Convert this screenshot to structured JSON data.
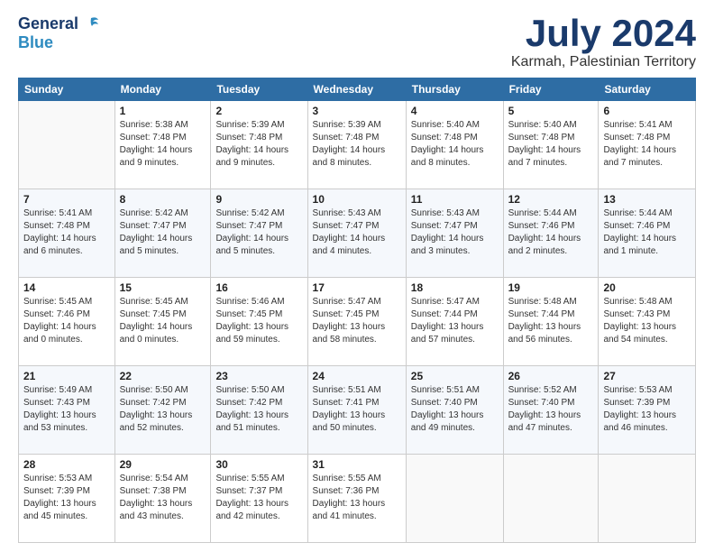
{
  "logo": {
    "line1": "General",
    "line2": "Blue"
  },
  "header": {
    "month": "July 2024",
    "location": "Karmah, Palestinian Territory"
  },
  "columns": [
    "Sunday",
    "Monday",
    "Tuesday",
    "Wednesday",
    "Thursday",
    "Friday",
    "Saturday"
  ],
  "weeks": [
    [
      {
        "day": "",
        "info": ""
      },
      {
        "day": "1",
        "info": "Sunrise: 5:38 AM\nSunset: 7:48 PM\nDaylight: 14 hours\nand 9 minutes."
      },
      {
        "day": "2",
        "info": "Sunrise: 5:39 AM\nSunset: 7:48 PM\nDaylight: 14 hours\nand 9 minutes."
      },
      {
        "day": "3",
        "info": "Sunrise: 5:39 AM\nSunset: 7:48 PM\nDaylight: 14 hours\nand 8 minutes."
      },
      {
        "day": "4",
        "info": "Sunrise: 5:40 AM\nSunset: 7:48 PM\nDaylight: 14 hours\nand 8 minutes."
      },
      {
        "day": "5",
        "info": "Sunrise: 5:40 AM\nSunset: 7:48 PM\nDaylight: 14 hours\nand 7 minutes."
      },
      {
        "day": "6",
        "info": "Sunrise: 5:41 AM\nSunset: 7:48 PM\nDaylight: 14 hours\nand 7 minutes."
      }
    ],
    [
      {
        "day": "7",
        "info": "Sunrise: 5:41 AM\nSunset: 7:48 PM\nDaylight: 14 hours\nand 6 minutes."
      },
      {
        "day": "8",
        "info": "Sunrise: 5:42 AM\nSunset: 7:47 PM\nDaylight: 14 hours\nand 5 minutes."
      },
      {
        "day": "9",
        "info": "Sunrise: 5:42 AM\nSunset: 7:47 PM\nDaylight: 14 hours\nand 5 minutes."
      },
      {
        "day": "10",
        "info": "Sunrise: 5:43 AM\nSunset: 7:47 PM\nDaylight: 14 hours\nand 4 minutes."
      },
      {
        "day": "11",
        "info": "Sunrise: 5:43 AM\nSunset: 7:47 PM\nDaylight: 14 hours\nand 3 minutes."
      },
      {
        "day": "12",
        "info": "Sunrise: 5:44 AM\nSunset: 7:46 PM\nDaylight: 14 hours\nand 2 minutes."
      },
      {
        "day": "13",
        "info": "Sunrise: 5:44 AM\nSunset: 7:46 PM\nDaylight: 14 hours\nand 1 minute."
      }
    ],
    [
      {
        "day": "14",
        "info": "Sunrise: 5:45 AM\nSunset: 7:46 PM\nDaylight: 14 hours\nand 0 minutes."
      },
      {
        "day": "15",
        "info": "Sunrise: 5:45 AM\nSunset: 7:45 PM\nDaylight: 14 hours\nand 0 minutes."
      },
      {
        "day": "16",
        "info": "Sunrise: 5:46 AM\nSunset: 7:45 PM\nDaylight: 13 hours\nand 59 minutes."
      },
      {
        "day": "17",
        "info": "Sunrise: 5:47 AM\nSunset: 7:45 PM\nDaylight: 13 hours\nand 58 minutes."
      },
      {
        "day": "18",
        "info": "Sunrise: 5:47 AM\nSunset: 7:44 PM\nDaylight: 13 hours\nand 57 minutes."
      },
      {
        "day": "19",
        "info": "Sunrise: 5:48 AM\nSunset: 7:44 PM\nDaylight: 13 hours\nand 56 minutes."
      },
      {
        "day": "20",
        "info": "Sunrise: 5:48 AM\nSunset: 7:43 PM\nDaylight: 13 hours\nand 54 minutes."
      }
    ],
    [
      {
        "day": "21",
        "info": "Sunrise: 5:49 AM\nSunset: 7:43 PM\nDaylight: 13 hours\nand 53 minutes."
      },
      {
        "day": "22",
        "info": "Sunrise: 5:50 AM\nSunset: 7:42 PM\nDaylight: 13 hours\nand 52 minutes."
      },
      {
        "day": "23",
        "info": "Sunrise: 5:50 AM\nSunset: 7:42 PM\nDaylight: 13 hours\nand 51 minutes."
      },
      {
        "day": "24",
        "info": "Sunrise: 5:51 AM\nSunset: 7:41 PM\nDaylight: 13 hours\nand 50 minutes."
      },
      {
        "day": "25",
        "info": "Sunrise: 5:51 AM\nSunset: 7:40 PM\nDaylight: 13 hours\nand 49 minutes."
      },
      {
        "day": "26",
        "info": "Sunrise: 5:52 AM\nSunset: 7:40 PM\nDaylight: 13 hours\nand 47 minutes."
      },
      {
        "day": "27",
        "info": "Sunrise: 5:53 AM\nSunset: 7:39 PM\nDaylight: 13 hours\nand 46 minutes."
      }
    ],
    [
      {
        "day": "28",
        "info": "Sunrise: 5:53 AM\nSunset: 7:39 PM\nDaylight: 13 hours\nand 45 minutes."
      },
      {
        "day": "29",
        "info": "Sunrise: 5:54 AM\nSunset: 7:38 PM\nDaylight: 13 hours\nand 43 minutes."
      },
      {
        "day": "30",
        "info": "Sunrise: 5:55 AM\nSunset: 7:37 PM\nDaylight: 13 hours\nand 42 minutes."
      },
      {
        "day": "31",
        "info": "Sunrise: 5:55 AM\nSunset: 7:36 PM\nDaylight: 13 hours\nand 41 minutes."
      },
      {
        "day": "",
        "info": ""
      },
      {
        "day": "",
        "info": ""
      },
      {
        "day": "",
        "info": ""
      }
    ]
  ]
}
